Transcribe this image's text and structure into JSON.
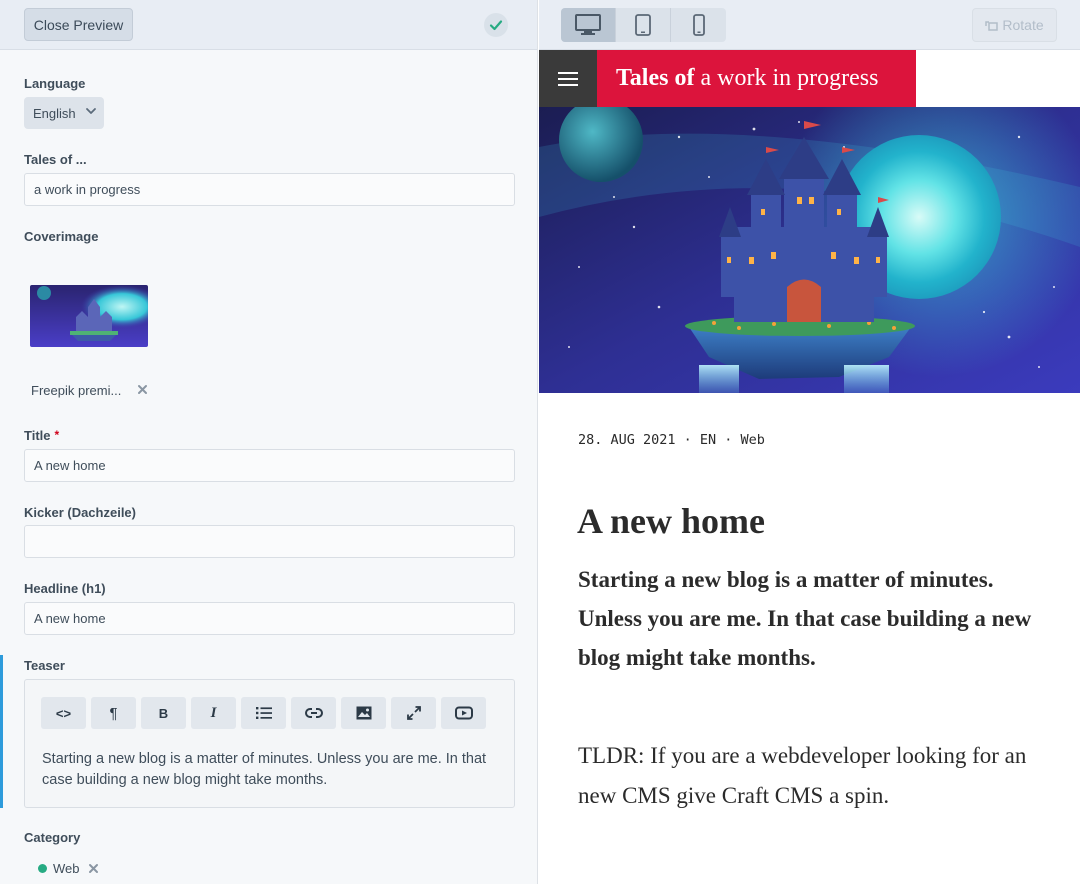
{
  "editor": {
    "close_preview_label": "Close Preview",
    "saved_icon": "check-icon",
    "fields": {
      "language": {
        "label": "Language",
        "value": "English",
        "icon": "chevron-down-icon"
      },
      "tales_of": {
        "label": "Tales of ...",
        "value": "a work in progress"
      },
      "coverimage": {
        "label": "Coverimage",
        "asset_name": "Freepik premi...",
        "remove_icon": "x-icon"
      },
      "title": {
        "label": "Title",
        "required_mark": "*",
        "value": "A new home"
      },
      "kicker": {
        "label": "Kicker (Dachzeile)",
        "value": ""
      },
      "headline": {
        "label": "Headline (h1)",
        "value": "A new home"
      },
      "teaser": {
        "label": "Teaser",
        "toolbar": {
          "source": "<>",
          "paragraph": "¶",
          "bold": "B",
          "italic": "I"
        },
        "toolbar_icons": [
          "code-icon",
          "paragraph-icon",
          "bold-icon",
          "italic-icon",
          "list-icon",
          "link-icon",
          "image-icon",
          "fullscreen-icon",
          "video-icon"
        ],
        "value": "Starting a new blog is a matter of minutes. Unless you are me. In that case building a new blog might take months."
      },
      "category": {
        "label": "Category",
        "value": "Web",
        "color": "#27ab83"
      }
    },
    "colors": {
      "accent": "#2d9bdb",
      "required": "#d0021b"
    }
  },
  "preview": {
    "devices": [
      "desktop-icon",
      "tablet-icon",
      "phone-icon"
    ],
    "active_device": "desktop",
    "rotate_label": "Rotate",
    "site": {
      "menu_icon": "hamburger-icon",
      "title_bold": "Tales of",
      "title_rest": "a work in progress",
      "brand_color": "#dc143c"
    },
    "post": {
      "meta": "28. AUG 2021 · EN · Web",
      "title": "A new home",
      "teaser": "Starting a new blog is a matter of minutes. Unless you are me. In that case building a new blog might take months.",
      "body": "TLDR: If you are a webdeveloper looking for an new CMS give Craft CMS a spin."
    }
  }
}
